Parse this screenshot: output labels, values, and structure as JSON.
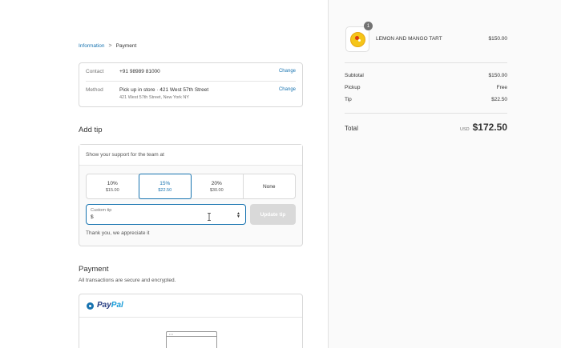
{
  "breadcrumb": {
    "information": "Information",
    "separator": ">",
    "current": "Payment"
  },
  "review": {
    "contact_label": "Contact",
    "contact_value": "+91 98989 81000",
    "contact_change": "Change",
    "method_label": "Method",
    "method_value": "Pick up in store · 421 West 57th Street",
    "method_address": "421 West 57th Street, New York NY",
    "method_change": "Change"
  },
  "tip": {
    "heading": "Add tip",
    "support_text": "Show your support for the team at",
    "options": [
      {
        "percent": "10%",
        "amount": "$15.00"
      },
      {
        "percent": "15%",
        "amount": "$22.50"
      },
      {
        "percent": "20%",
        "amount": "$30.00"
      },
      {
        "percent": "None",
        "amount": ""
      }
    ],
    "selected": "15%",
    "custom_label": "Custom tip",
    "custom_value": "$",
    "update_button": "Update tip",
    "thanks": "Thank you, we appreciate it"
  },
  "payment": {
    "heading": "Payment",
    "subtext": "All transactions are secure and encrypted.",
    "method_pay": "Pay",
    "method_pal": "Pal"
  },
  "summary": {
    "product_name": "LEMON AND MANGO TART",
    "product_qty": "1",
    "product_price": "$150.00",
    "subtotal_label": "Subtotal",
    "subtotal_value": "$150.00",
    "pickup_label": "Pickup",
    "pickup_value": "Free",
    "tip_label": "Tip",
    "tip_value": "$22.50",
    "total_label": "Total",
    "total_currency": "USD",
    "total_value": "$172.50"
  },
  "colors": {
    "accent": "#1773b0",
    "paypal_dark": "#253b80",
    "paypal_light": "#179bd7"
  }
}
